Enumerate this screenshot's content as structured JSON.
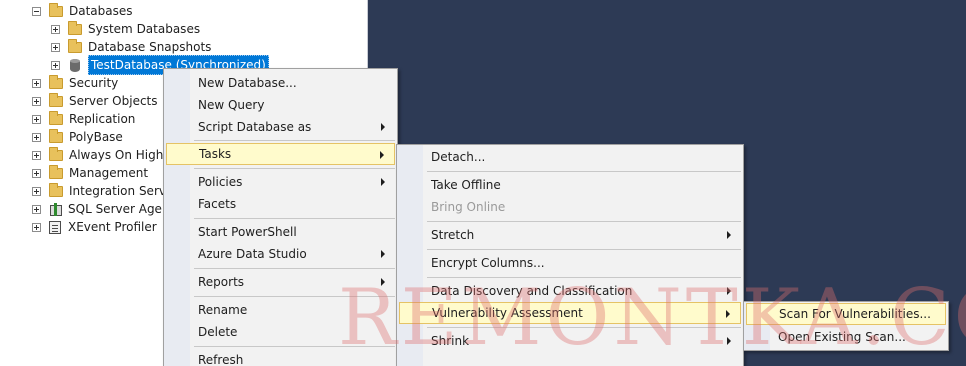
{
  "tree": {
    "items": [
      {
        "label": "Databases"
      },
      {
        "label": "System Databases"
      },
      {
        "label": "Database Snapshots"
      },
      {
        "label": "TestDatabase (Synchronized)"
      },
      {
        "label": "Security"
      },
      {
        "label": "Server Objects"
      },
      {
        "label": "Replication"
      },
      {
        "label": "PolyBase"
      },
      {
        "label": "Always On High A"
      },
      {
        "label": "Management"
      },
      {
        "label": "Integration Service"
      },
      {
        "label": "SQL Server Agent"
      },
      {
        "label": "XEvent Profiler"
      }
    ]
  },
  "context_menu": {
    "items": [
      {
        "label": "New Database..."
      },
      {
        "label": "New Query"
      },
      {
        "label": "Script Database as"
      },
      {
        "label": "Tasks"
      },
      {
        "label": "Policies"
      },
      {
        "label": "Facets"
      },
      {
        "label": "Start PowerShell"
      },
      {
        "label": "Azure Data Studio"
      },
      {
        "label": "Reports"
      },
      {
        "label": "Rename"
      },
      {
        "label": "Delete"
      },
      {
        "label": "Refresh"
      }
    ]
  },
  "tasks_menu": {
    "items": [
      {
        "label": "Detach..."
      },
      {
        "label": "Take Offline"
      },
      {
        "label": "Bring Online"
      },
      {
        "label": "Stretch"
      },
      {
        "label": "Encrypt Columns..."
      },
      {
        "label": "Data Discovery and Classification"
      },
      {
        "label": "Vulnerability Assessment"
      },
      {
        "label": "Shrink"
      }
    ]
  },
  "va_menu": {
    "items": [
      {
        "label": "Scan For Vulnerabilities..."
      },
      {
        "label": "Open Existing Scan..."
      }
    ]
  },
  "watermark": "REMONTKA.COM",
  "colors": {
    "background": "#2d3a55",
    "selection": "#0078d7",
    "menu_highlight": "#fffbcc",
    "menu_highlight_border": "#e5c365",
    "watermark": "#dc6e6e"
  }
}
